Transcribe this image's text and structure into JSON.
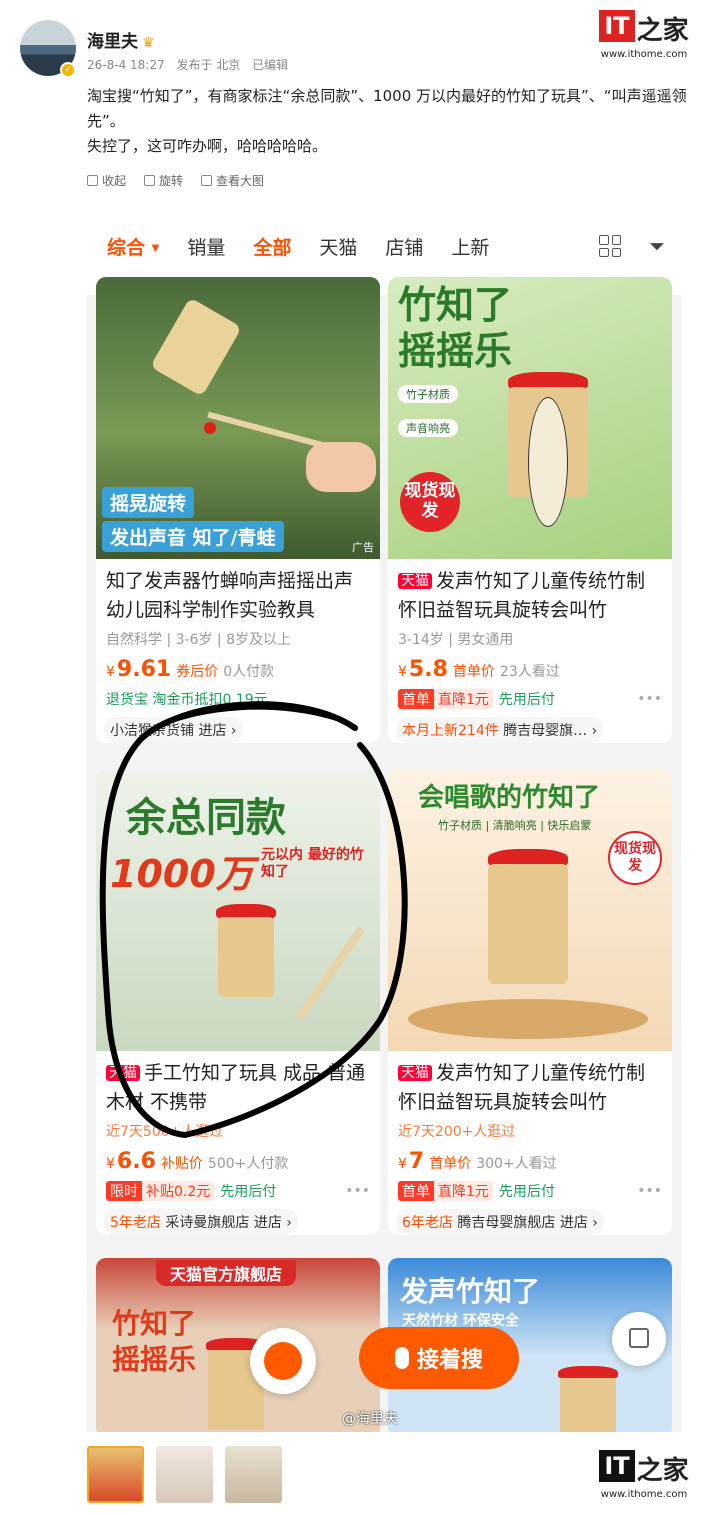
{
  "post": {
    "username": "海里夫",
    "meta": {
      "time": "26-8-4 18:27",
      "from": "发布于 北京",
      "edited": "已编辑"
    },
    "text_line1": "淘宝搜“竹知了”，有商家标注“余总同款”、1000 万以内最好的竹知了玩具”、“叫声遥遥领先”。",
    "text_line2": "失控了，这可咋办啊，哈哈哈哈哈。",
    "actions": [
      "收起",
      "旋转",
      "查看大图"
    ]
  },
  "brand": {
    "logo_text": "IT",
    "logo_zh": "之家",
    "url": "www.ithome.com"
  },
  "taobao": {
    "tabs": [
      "综合",
      "销量",
      "全部",
      "天猫",
      "店铺",
      "上新"
    ],
    "cards": [
      {
        "overlay1": "摇晃旋转",
        "overlay2": "发出声音 知了/青蛙",
        "ad": "广告",
        "title": "知了发声器竹蝉响声摇摇出声幼儿园科学制作实验教具",
        "tags": "自然科学 | 3-6岁 | 8岁及以上",
        "cur": "¥",
        "price": "9.61",
        "price_label": "券后价",
        "sold": "0人付款",
        "promo": "退货宝  淘金币抵扣0.19元",
        "shop": "小洁猴杂货铺 进店 ›"
      },
      {
        "overlay1": "竹知了",
        "overlay2": "摇摇乐",
        "badge1": "竹子材质",
        "badge2": "声音响亮",
        "badge3": "现货现发",
        "tmall": "天猫",
        "title": "发声竹知了儿童传统竹制怀旧益智玩具旋转会叫竹",
        "tags": "3-14岁 | 男女通用",
        "cur": "¥",
        "price": "5.8",
        "price_label": "首单价",
        "sold": "23人看过",
        "promo_a": "首单",
        "promo_b": "直降1元",
        "promo_c": "先用后付",
        "shop_tag": "本月上新214件",
        "shop": "腾吉母婴旗… ›"
      },
      {
        "overlay1": "余总同款",
        "overlay2": "1000万",
        "overlay3": "元以内 最好的竹知了",
        "tmall": "天猫",
        "title": "手工竹知了玩具 成品 普通木材 不携带",
        "tags": "近7天500+人逛过",
        "cur": "¥",
        "price": "6.6",
        "price_label": "补贴价",
        "sold": "500+人付款",
        "promo_a": "限时",
        "promo_b": "补贴0.2元",
        "promo_c": "先用后付",
        "shop_age": "5年老店",
        "shop": "采诗曼旗舰店 进店 ›"
      },
      {
        "overlay1": "会唱歌的竹知了",
        "overlay2": "竹子材质 | 清脆响亮 | 快乐启蒙",
        "badge": "现货现发",
        "tmall": "天猫",
        "title": "发声竹知了儿童传统竹制怀旧益智玩具旋转会叫竹",
        "tags": "近7天200+人逛过",
        "cur": "¥",
        "price": "7",
        "price_label": "首单价",
        "sold": "300+人看过",
        "promo_a": "首单",
        "promo_b": "直降1元",
        "promo_c": "先用后付",
        "shop_age": "6年老店",
        "shop": "腾吉母婴旗舰店 进店 ›"
      },
      {
        "overlay1": "天猫官方旗舰店",
        "overlay2": "竹知了",
        "overlay3": "摇摇乐"
      },
      {
        "overlay1": "发声竹知了",
        "overlay2": "天然竹材 环保安全"
      }
    ],
    "search_button": "接着搜",
    "watermark": "@海里夫"
  }
}
